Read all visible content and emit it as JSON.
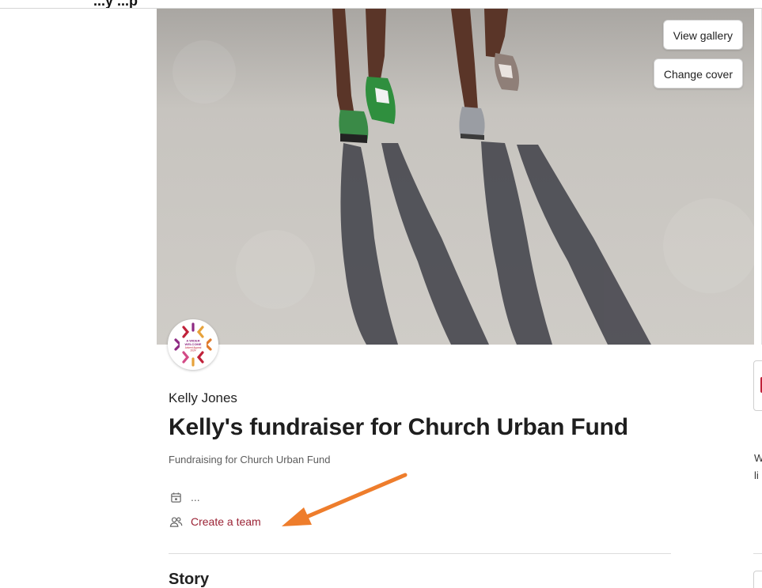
{
  "header": {
    "partial_text": "...y ...p"
  },
  "cover": {
    "view_gallery_label": "View gallery",
    "change_cover_label": "Change cover"
  },
  "avatar": {
    "logo_text": [
      "A WIDER",
      "WELCOME",
      "Advent Appeal",
      "2024"
    ]
  },
  "fundraiser": {
    "organiser": "Kelly Jones",
    "title": "Kelly's fundraiser for Church Urban Fund",
    "subtitle": "Fundraising for Church Urban Fund",
    "date_text": "...",
    "create_team_label": "Create a team"
  },
  "story": {
    "heading": "Story"
  },
  "sidebar": {
    "partial_text_line1": "W",
    "partial_text_line2": "li"
  },
  "colors": {
    "link": "#9b2335",
    "arrow": "#ee7d2c",
    "accent": "#c0223a"
  },
  "icons": {
    "date": "calendar-icon",
    "team": "people-icon"
  }
}
